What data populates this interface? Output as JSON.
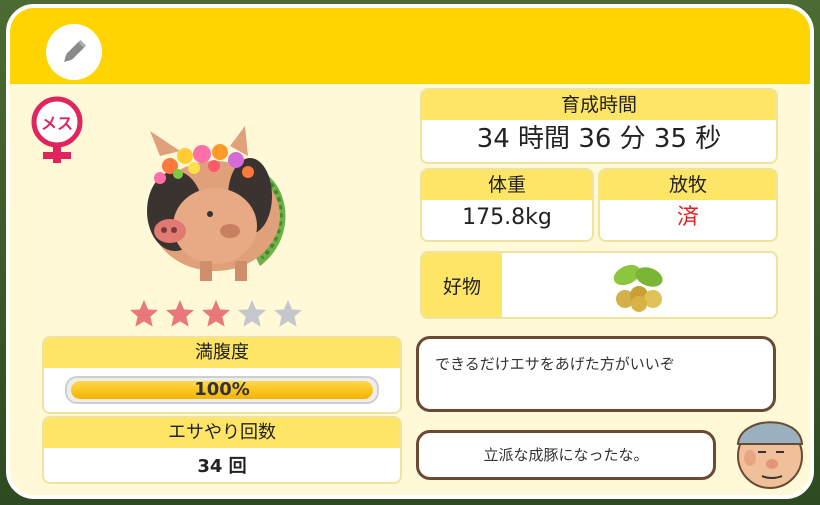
{
  "gender": {
    "label": "メス",
    "color": "#e0245e"
  },
  "stars": {
    "filled": 3,
    "total": 5,
    "filled_color": "#e8787a",
    "empty_color": "#c4c7cc"
  },
  "satiety": {
    "label": "満腹度",
    "value_text": "100%",
    "value": 1.0
  },
  "feed_count": {
    "label": "エサやり回数",
    "value": "34 回"
  },
  "raising_time": {
    "label": "育成時間",
    "value": "34 時間 36 分 35 秒"
  },
  "weight": {
    "label": "体重",
    "value": "175.8kg"
  },
  "grazing": {
    "label": "放牧",
    "value": "済",
    "value_color": "#e02020"
  },
  "favorite": {
    "label": "好物",
    "icon": "acorn-leaf-icon"
  },
  "farmer": {
    "advice": "できるだけエサをあげた方がいいぞ",
    "comment": "立派な成豚になったな。"
  },
  "colors": {
    "header": "#ffd400",
    "panel": "#fff9d8",
    "box_header": "#ffe566"
  }
}
